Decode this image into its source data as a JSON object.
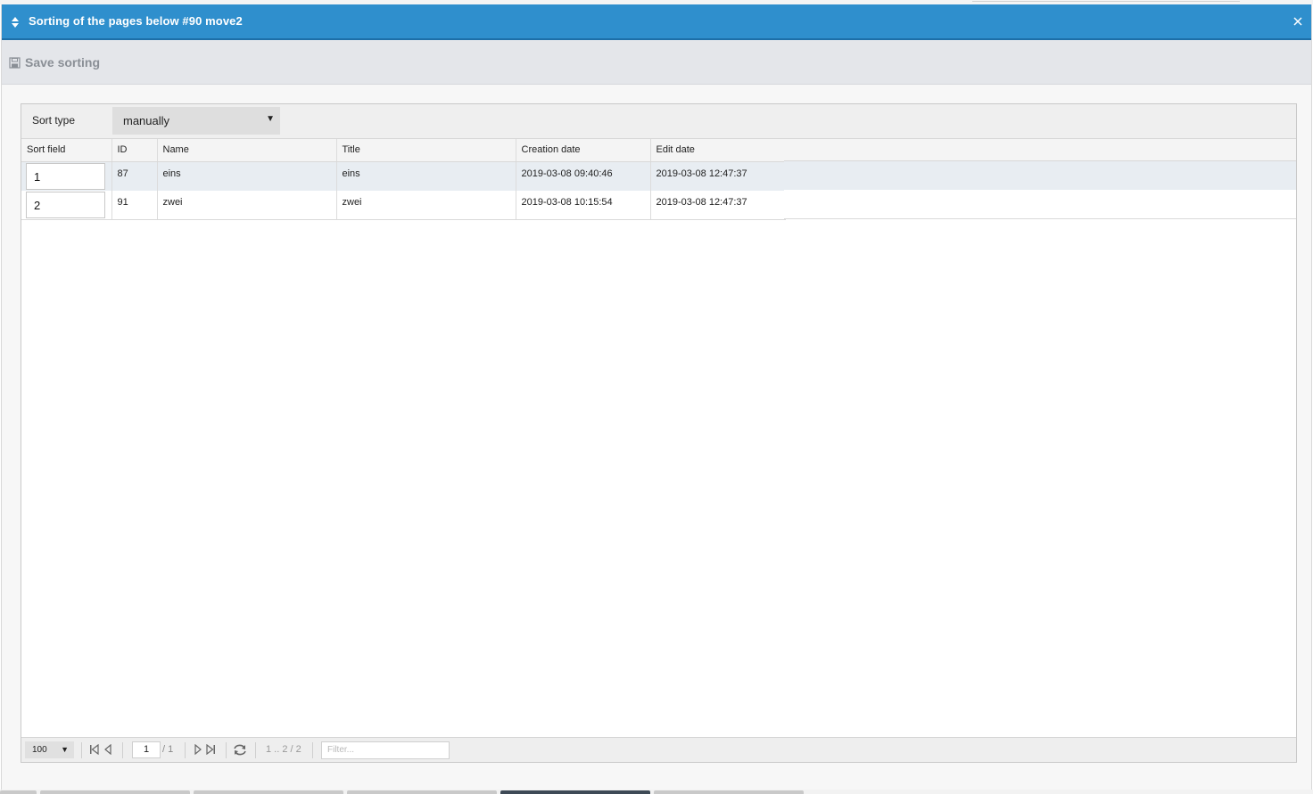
{
  "dialog": {
    "title": "Sorting of the pages below #90 move2",
    "colors": {
      "titlebar": "#2f8fcd",
      "toolbar": "#e4e6ea"
    }
  },
  "toolbar": {
    "save_label": "Save sorting"
  },
  "sort": {
    "label": "Sort type",
    "selected": "manually"
  },
  "grid": {
    "columns": [
      "Sort field",
      "ID",
      "Name",
      "Title",
      "Creation date",
      "Edit date"
    ],
    "rows": [
      {
        "sort": "1",
        "id": "87",
        "name": "eins",
        "title": "eins",
        "created": "2019-03-08 09:40:46",
        "edited": "2019-03-08 12:47:37"
      },
      {
        "sort": "2",
        "id": "91",
        "name": "zwei",
        "title": "zwei",
        "created": "2019-03-08 10:15:54",
        "edited": "2019-03-08 12:47:37"
      }
    ]
  },
  "pager": {
    "page_size": "100",
    "page": "1",
    "total_pages": "/ 1",
    "range": "1 .. 2 / 2",
    "filter_placeholder": "Filter..."
  }
}
